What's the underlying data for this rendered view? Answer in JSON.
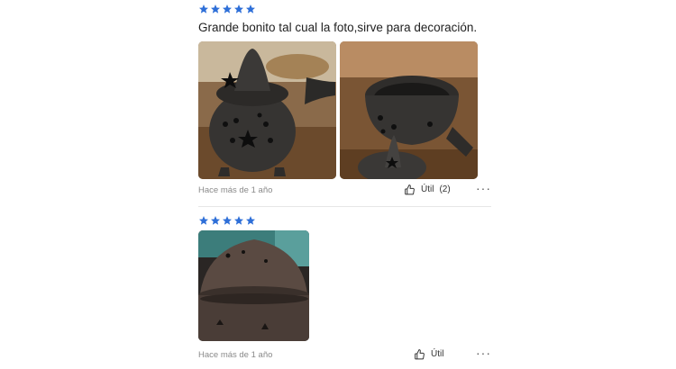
{
  "colors": {
    "star": "#2e6fd8",
    "divider": "#e6e6e6",
    "timestamp": "#8a8a8a"
  },
  "reviews": [
    {
      "rating": 5,
      "text": "Grande bonito tal cual la foto,sirve para decoración.",
      "photos": [
        "clay-pot-with-star-cutouts-and-lid",
        "open-clay-pot-with-lid-beside"
      ],
      "timestamp": "Hace más de 1 año",
      "helpful_label": "Útil",
      "helpful_count": "(2)",
      "more_icon": "ellipsis-icon"
    },
    {
      "rating": 5,
      "text": "",
      "photos": [
        "closeup-clay-pot-lid"
      ],
      "timestamp": "Hace más de 1 año",
      "helpful_label": "Útil",
      "helpful_count": "",
      "more_icon": "ellipsis-icon"
    }
  ]
}
